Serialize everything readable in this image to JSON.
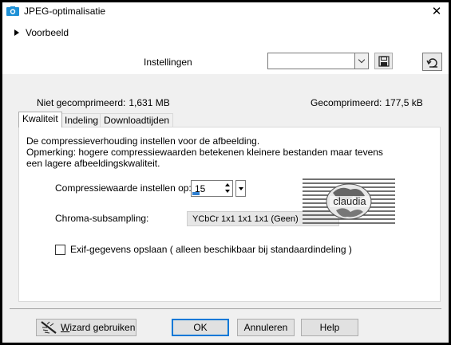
{
  "window": {
    "title": "JPEG-optimalisatie",
    "close_glyph": "✕",
    "app_icon": "camera-icon"
  },
  "preview": {
    "label": "Voorbeeld"
  },
  "settings": {
    "label": "Instellingen",
    "preset_value": "",
    "save_icon": "floppy-disk-icon",
    "reset_icon": "reset-defaults-icon"
  },
  "stats": {
    "uncompressed_label": "Niet gecomprimeerd:",
    "uncompressed_value": "1,631 MB",
    "compressed_label": "Gecomprimeerd:",
    "compressed_value": "177,5 kB"
  },
  "tabs": [
    {
      "label": "Kwaliteit",
      "active": true
    },
    {
      "label": "Indeling",
      "active": false
    },
    {
      "label": "Downloadtijden",
      "active": false
    }
  ],
  "quality": {
    "desc_line1": "De compressieverhouding instellen voor de afbeelding.",
    "desc_line2": "Opmerking:  hogere compressiewaarden betekenen kleinere bestanden maar tevens",
    "desc_line3": "een lagere afbeeldingskwaliteit.",
    "compression_label": "Compressiewaarde instellen op:",
    "compression_value": "15",
    "chroma_label": "Chroma-subsampling:",
    "chroma_value": "YCbCr  1x1  1x1  1x1  (Geen)",
    "exif_label": "Exif-gegevens opslaan ( alleen beschikbaar bij standaardindeling )",
    "exif_checked": false,
    "watermark_text": "claudia"
  },
  "buttons": {
    "wizard_label_u": "W",
    "wizard_label_rest": "izard gebruiken",
    "ok": "OK",
    "cancel": "Annuleren",
    "help": "Help"
  },
  "colors": {
    "accent": "#0078d7",
    "icon_blue": "#1e90d6",
    "dialog_bg": "#f0f0f0"
  }
}
